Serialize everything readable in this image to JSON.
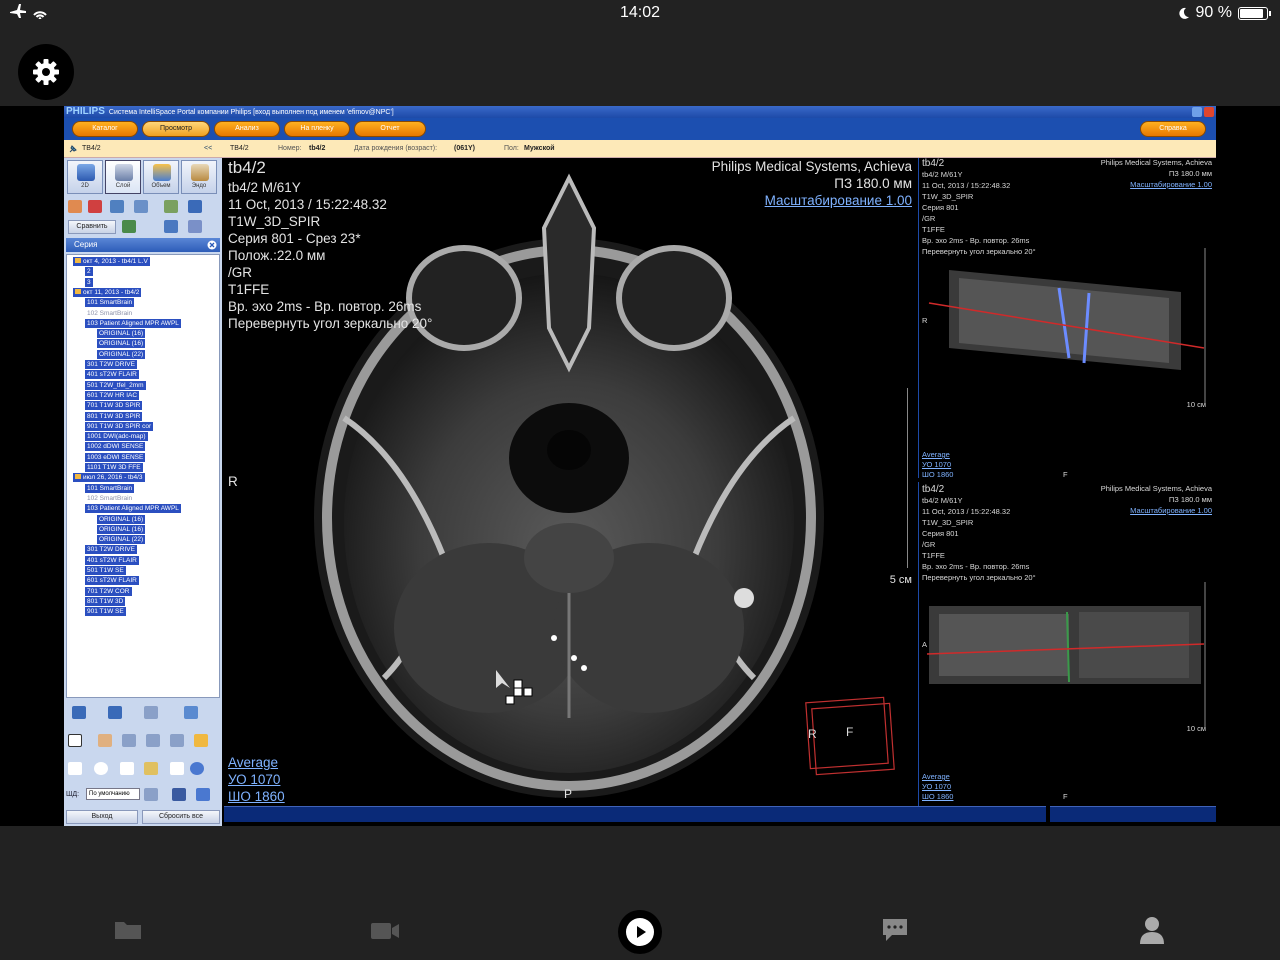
{
  "status_bar": {
    "time": "14:02",
    "battery": "90 %",
    "battery_level": 0.9
  },
  "app": {
    "title_brand": "PHILIPS",
    "title_text": "Система IntelliSpace Portal компании Philips [вход выполнен под именем 'efimov@NPC']",
    "menu": [
      "Каталог",
      "Просмотр",
      "Анализ",
      "На пленку",
      "Отчет"
    ],
    "active_menu": "Просмотр",
    "help": "Справка",
    "patient_tab": "TB4/2",
    "collapse": "<<",
    "info": {
      "id": "TB4/2",
      "number_label": "Номер:",
      "number": "tb4/2",
      "dob_label": "Дата рождения (возраст):",
      "dob": "(061Y)",
      "sex_label": "Пол:",
      "sex": "Мужской"
    }
  },
  "left_panel": {
    "tabs": [
      "2D",
      "Слой",
      "Объем",
      "Эндо"
    ],
    "compare": "Сравнить",
    "series_header": "Серия",
    "tree": [
      {
        "label": "окт 4, 2013 - tb4/1 L.V",
        "type": "folder",
        "state": "sel",
        "indent": 0
      },
      {
        "label": "2",
        "type": "item",
        "state": "sel",
        "indent": 1
      },
      {
        "label": "3",
        "type": "item",
        "state": "sel",
        "indent": 1
      },
      {
        "label": "окт 11, 2013 - tb4/2",
        "type": "folder",
        "state": "sel",
        "indent": 0
      },
      {
        "label": "101 SmartBrain",
        "type": "item",
        "state": "sel",
        "indent": 1
      },
      {
        "label": "102 SmartBrain",
        "type": "item",
        "state": "dim",
        "indent": 1
      },
      {
        "label": "103 Patient Aligned MPR AWPL",
        "type": "item",
        "state": "sel",
        "indent": 1
      },
      {
        "label": "ORIGINAL (16)",
        "type": "item",
        "state": "sel",
        "indent": 2
      },
      {
        "label": "ORIGINAL (16)",
        "type": "item",
        "state": "sel",
        "indent": 2
      },
      {
        "label": "ORIGINAL (22)",
        "type": "item",
        "state": "sel",
        "indent": 2
      },
      {
        "label": "301 T2W DRIVE",
        "type": "item",
        "state": "sel",
        "indent": 1
      },
      {
        "label": "401 sT2W FLAIR",
        "type": "item",
        "state": "sel",
        "indent": 1
      },
      {
        "label": "501 T2W_tfel_2mm",
        "type": "item",
        "state": "sel",
        "indent": 1
      },
      {
        "label": "601 T2W HR IAC",
        "type": "item",
        "state": "sel",
        "indent": 1
      },
      {
        "label": "701 T1W 3D SPIR",
        "type": "item",
        "state": "sel",
        "indent": 1
      },
      {
        "label": "801 T1W 3D SPIR",
        "type": "item",
        "state": "sel",
        "indent": 1
      },
      {
        "label": "901 T1W 3D SPIR cor",
        "type": "item",
        "state": "sel",
        "indent": 1
      },
      {
        "label": "1001 DWI(adc-map)",
        "type": "item",
        "state": "sel",
        "indent": 1
      },
      {
        "label": "1002 dDWI SENSE",
        "type": "item",
        "state": "sel",
        "indent": 1
      },
      {
        "label": "1003 eDWI SENSE",
        "type": "item",
        "state": "sel",
        "indent": 1
      },
      {
        "label": "1101 T1W 3D FFE",
        "type": "item",
        "state": "sel",
        "indent": 1
      },
      {
        "label": "июл 26, 2016 - tb4/3",
        "type": "folder",
        "state": "sel",
        "indent": 0
      },
      {
        "label": "101 SmartBrain",
        "type": "item",
        "state": "sel",
        "indent": 1
      },
      {
        "label": "102 SmartBrain",
        "type": "item",
        "state": "dim",
        "indent": 1
      },
      {
        "label": "103 Patient Aligned MPR AWPL",
        "type": "item",
        "state": "sel",
        "indent": 1
      },
      {
        "label": "ORIGINAL (16)",
        "type": "item",
        "state": "sel",
        "indent": 2
      },
      {
        "label": "ORIGINAL (16)",
        "type": "item",
        "state": "sel",
        "indent": 2
      },
      {
        "label": "ORIGINAL (22)",
        "type": "item",
        "state": "sel",
        "indent": 2
      },
      {
        "label": "301 T2W DRIVE",
        "type": "item",
        "state": "sel",
        "indent": 1
      },
      {
        "label": "401 sT2W FLAIR",
        "type": "item",
        "state": "sel",
        "indent": 1
      },
      {
        "label": "501 T1W SE",
        "type": "item",
        "state": "sel",
        "indent": 1
      },
      {
        "label": "601 sT2W FLAIR",
        "type": "item",
        "state": "sel",
        "indent": 1
      },
      {
        "label": "701 T2W COR",
        "type": "item",
        "state": "sel",
        "indent": 1
      },
      {
        "label": "801 T1W 3D",
        "type": "item",
        "state": "sel",
        "indent": 1
      },
      {
        "label": "901 T1W SE",
        "type": "item",
        "state": "sel",
        "indent": 1
      }
    ],
    "layout_label": "ШД:",
    "layout_select": "По умолчанию",
    "exit": "Выход",
    "reset_all": "Сбросить все"
  },
  "main_view": {
    "name": "tb4/2",
    "patient": "tb4/2 M/61Y",
    "datetime": "11 Oct, 2013 / 15:22:48.32",
    "protocol": "T1W_3D_SPIR",
    "series": "Серия 801 - Срез 23*",
    "position": "Полож.:22.0 мм",
    "orientation": "/GR",
    "sequence": "T1FFE",
    "echo": "Вр. эхо   2ms - Вр. повтор.  26ms",
    "flip": "Перевернуть угол зеркально 20°",
    "vendor": "Philips Medical Systems, Achieva",
    "fov": "ПЗ 180.0 мм",
    "zoom": "Масштабирование 1.00",
    "label_left": "R",
    "label_bottom": "P",
    "scale": "5 см",
    "window_mode": "Average",
    "wl": "УО   1070",
    "ww": "ШО  1860",
    "cube_r": "R",
    "cube_f": "F"
  },
  "side_views": [
    {
      "name": "tb4/2",
      "patient": "tb4/2 M/61Y",
      "datetime": "11 Oct, 2013 / 15:22:48.32",
      "protocol": "T1W_3D_SPIR",
      "series": "Серия 801",
      "orientation": "/GR",
      "sequence": "T1FFE",
      "echo": "Вр. эхо   2ms - Вр. повтор.  26ms",
      "flip": "Перевернуть угол зеркально 20°",
      "vendor": "Philips Medical Systems, Achieva",
      "fov": "ПЗ 180.0 мм",
      "zoom": "Масштабирование 1.00",
      "side_label": "R",
      "bottom_label": "F",
      "scale": "10 см",
      "window_mode": "Average",
      "wl": "УО   1070",
      "ww": "ШО   1860"
    },
    {
      "name": "tb4/2",
      "patient": "tb4/2 M/61Y",
      "datetime": "11 Oct, 2013 / 15:22:48.32",
      "protocol": "T1W_3D_SPIR",
      "series": "Серия 801",
      "orientation": "/GR",
      "sequence": "T1FFE",
      "echo": "Вр. эхо   2ms - Вр. повтор.  26ms",
      "flip": "Перевернуть угол зеркально 20°",
      "vendor": "Philips Medical Systems, Achieva",
      "fov": "ПЗ 180.0 мм",
      "zoom": "Масштабирование 1.00",
      "side_label": "A",
      "bottom_label": "F",
      "scale": "10 см",
      "window_mode": "Average",
      "wl": "УО   1070",
      "ww": "ШО   1860"
    }
  ],
  "nav": [
    "folder-icon",
    "video-icon",
    "play-icon",
    "chat-icon",
    "person-icon"
  ],
  "colors": {
    "menu_orange": "#f39a10",
    "window_blue": "#1c4fb0",
    "selection_blue": "#2b4fc0",
    "info_bar": "#fde9b8"
  }
}
